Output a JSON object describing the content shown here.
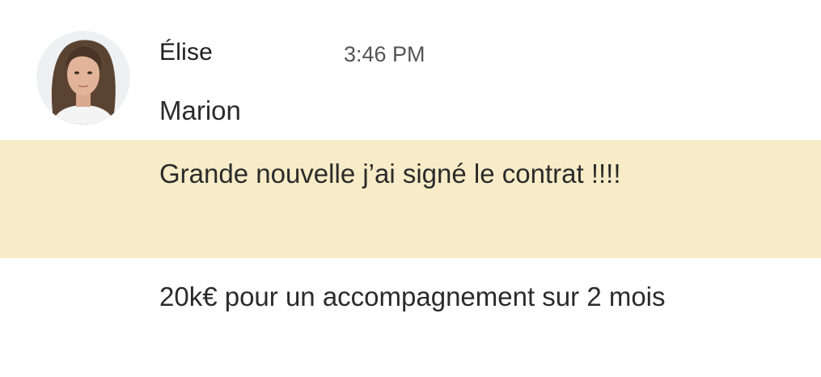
{
  "message": {
    "sender_name": "Élise",
    "timestamp": "3:46 PM",
    "lines": [
      "Marion",
      "Grande nouvelle j’ai signé le contrat !!!!",
      "20k€ pour un accompagnement sur 2 mois"
    ],
    "highlight_color": "#f7ecc7"
  }
}
